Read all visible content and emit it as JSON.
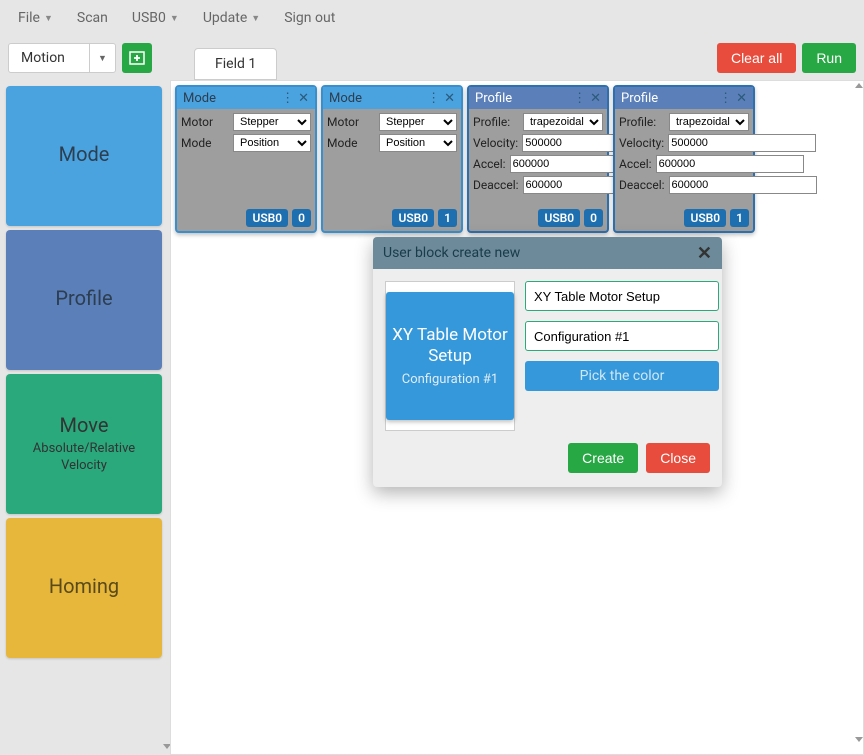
{
  "menubar": {
    "items": [
      {
        "label": "File",
        "has_caret": true
      },
      {
        "label": "Scan",
        "has_caret": false
      },
      {
        "label": "USB0",
        "has_caret": true
      },
      {
        "label": "Update",
        "has_caret": true
      },
      {
        "label": "Sign out",
        "has_caret": false
      }
    ]
  },
  "toolbar": {
    "dropdown_label": "Motion",
    "tab_label": "Field 1",
    "clear_label": "Clear all",
    "run_label": "Run"
  },
  "palette": [
    {
      "title": "Mode",
      "sub": "",
      "cls": "pb-mode"
    },
    {
      "title": "Profile",
      "sub": "",
      "cls": "pb-profile"
    },
    {
      "title": "Move",
      "sub": "Absolute/Relative Velocity",
      "cls": "pb-move"
    },
    {
      "title": "Homing",
      "sub": "",
      "cls": "pb-homing"
    }
  ],
  "blocks": {
    "mode": [
      {
        "title": "Mode",
        "motor_label": "Motor",
        "motor_value": "Stepper",
        "mode_label": "Mode",
        "mode_value": "Position",
        "port": "USB0",
        "index": "0"
      },
      {
        "title": "Mode",
        "motor_label": "Motor",
        "motor_value": "Stepper",
        "mode_label": "Mode",
        "mode_value": "Position",
        "port": "USB0",
        "index": "1"
      }
    ],
    "profile": [
      {
        "title": "Profile",
        "profile_label": "Profile:",
        "profile_value": "trapezoidal",
        "velocity_label": "Velocity:",
        "velocity_value": "500000",
        "accel_label": "Accel:",
        "accel_value": "600000",
        "deaccel_label": "Deaccel:",
        "deaccel_value": "600000",
        "port": "USB0",
        "index": "0"
      },
      {
        "title": "Profile",
        "profile_label": "Profile:",
        "profile_value": "trapezoidal",
        "velocity_label": "Velocity:",
        "velocity_value": "500000",
        "accel_label": "Accel:",
        "accel_value": "600000",
        "deaccel_label": "Deaccel:",
        "deaccel_value": "600000",
        "port": "USB0",
        "index": "1"
      }
    ]
  },
  "modal": {
    "title": "User block create new",
    "preview_title": "XY Table Motor Setup",
    "preview_sub": "Configuration #1",
    "name_value": "XY Table Motor Setup",
    "desc_value": "Configuration #1",
    "pick_color_label": "Pick the color",
    "create_label": "Create",
    "close_label": "Close"
  }
}
